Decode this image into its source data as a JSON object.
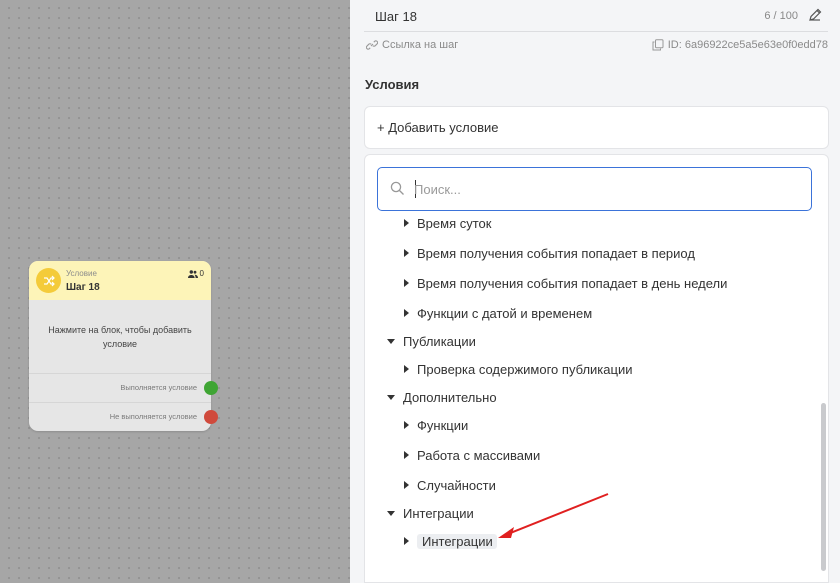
{
  "canvas": {
    "node": {
      "type_label": "Условие",
      "title": "Шаг 18",
      "users_count": "0",
      "body_text": "Нажмите на блок, чтобы добавить условие",
      "outputs": [
        {
          "label": "Выполняется условие",
          "color": "#3fa534"
        },
        {
          "label": "Не выполняется условие",
          "color": "#d04a3c"
        }
      ]
    }
  },
  "panel": {
    "step_name": "Шаг 18",
    "step_count": "6 / 100",
    "link_label": "Ссылка на шаг",
    "step_id": "ID: 6a96922ce5a5e63e0f0edd78",
    "section_title": "Условия",
    "add_condition_label": "+ Добавить условие",
    "search_placeholder": "Поиск...",
    "tree": [
      {
        "label": "Время суток",
        "level": 1,
        "expanded": false
      },
      {
        "label": "Время получения события попадает в период",
        "level": 1,
        "expanded": false
      },
      {
        "label": "Время получения события попадает в день недели",
        "level": 1,
        "expanded": false
      },
      {
        "label": "Функции с датой и временем",
        "level": 1,
        "expanded": false
      },
      {
        "label": "Публикации",
        "level": 0,
        "expanded": true
      },
      {
        "label": "Проверка содержимого публикации",
        "level": 1,
        "expanded": false
      },
      {
        "label": "Дополнительно",
        "level": 0,
        "expanded": true
      },
      {
        "label": "Функции",
        "level": 1,
        "expanded": false
      },
      {
        "label": "Работа с массивами",
        "level": 1,
        "expanded": false
      },
      {
        "label": "Случайности",
        "level": 1,
        "expanded": false
      },
      {
        "label": "Интеграции",
        "level": 0,
        "expanded": true
      },
      {
        "label": "Интеграции",
        "level": 1,
        "expanded": false,
        "highlighted": true
      }
    ]
  },
  "colors": {
    "accent_blue": "#3b73d9",
    "node_header": "#fdf4b8",
    "node_icon": "#f4cb3a",
    "annotation_arrow": "#e02020"
  }
}
